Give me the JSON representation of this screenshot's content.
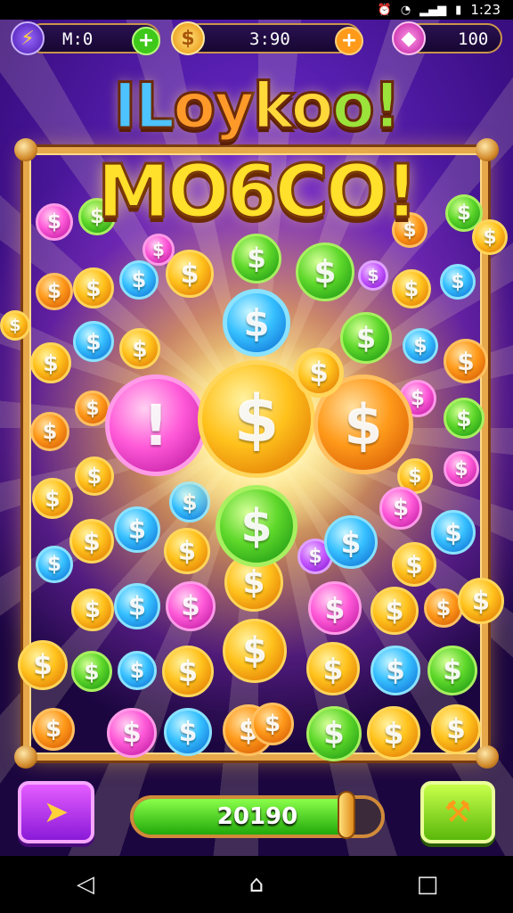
{
  "status_bar": {
    "time": "1:23",
    "icons": [
      "alarm-icon",
      "wifi-icon",
      "signal-icon",
      "battery-icon"
    ]
  },
  "resources": [
    {
      "name": "energy",
      "icon": "lightning-icon",
      "value": "M:0",
      "plus": "+",
      "accent": "#7a3cff"
    },
    {
      "name": "coins",
      "icon": "coin-icon",
      "value": "3:90",
      "plus": "+",
      "accent": "#ffb21c"
    },
    {
      "name": "gems",
      "icon": "gem-icon",
      "value": "100",
      "accent": "#ff3ad0"
    }
  ],
  "title": {
    "line1": [
      "IL",
      "oy",
      "ko",
      "o!"
    ],
    "line2": "MO6CO!"
  },
  "board": {
    "coin_symbol": "$",
    "special_symbol": "!"
  },
  "progress": {
    "label": "20190",
    "fraction": 0.86
  },
  "controls": {
    "left_icon": "play-arrow-icon",
    "right_icon": "hammer-icon"
  },
  "nav": {
    "back": "◁",
    "home": "⌂",
    "recents": "□"
  },
  "colors": {
    "gold": "#ffc21c",
    "green": "#5ed82a",
    "blue": "#36c0ff",
    "pink": "#ff5ad8",
    "orange": "#ff9a1a",
    "frame": "#e6a84a"
  }
}
